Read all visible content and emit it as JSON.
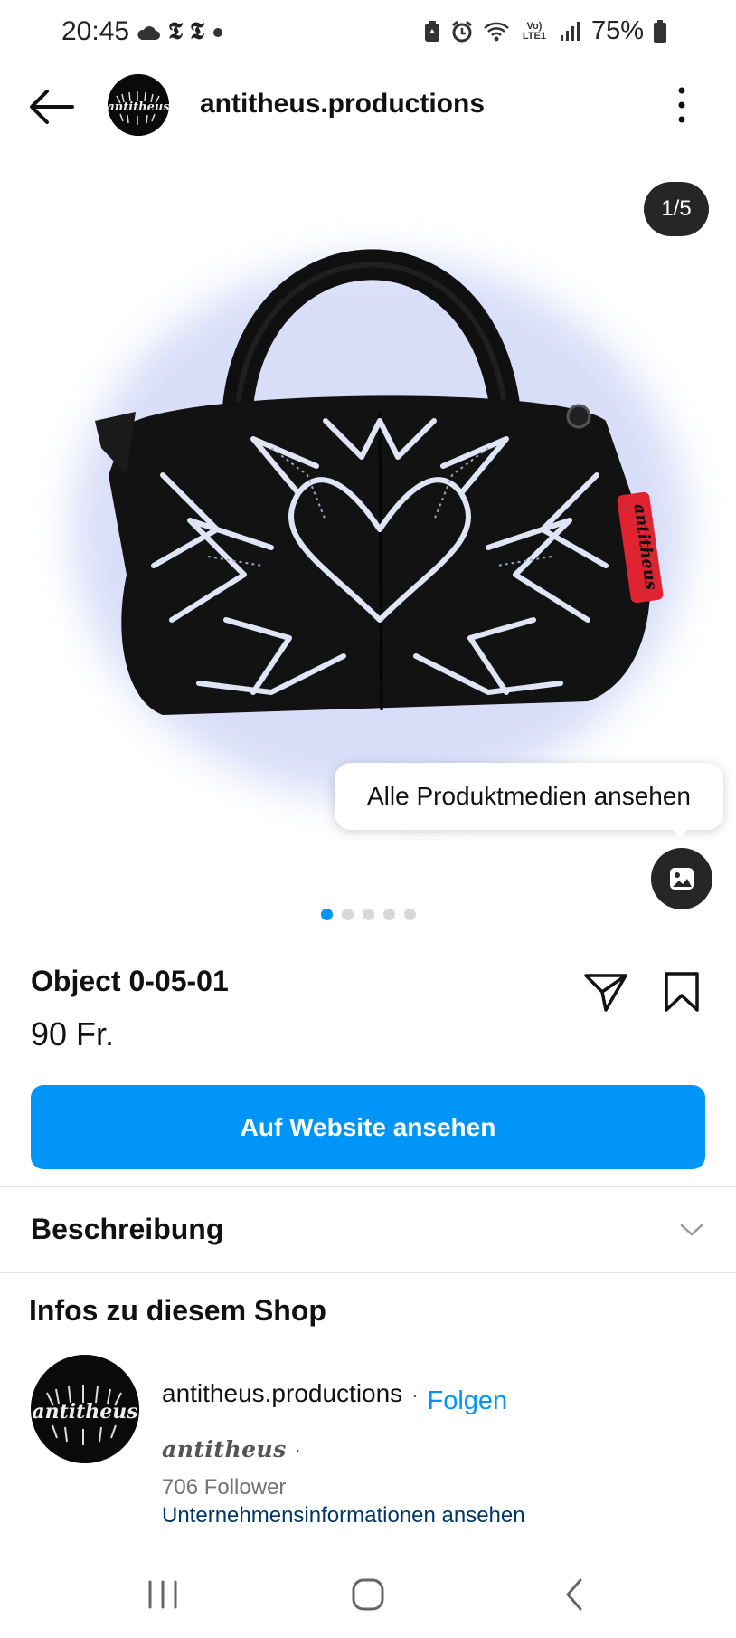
{
  "status_bar": {
    "time": "20:45",
    "battery_percent": "75%",
    "left_icons": [
      "cloud-icon",
      "nytimes-icon",
      "nytimes-icon",
      "dot-icon"
    ],
    "right_icons": [
      "battery-saver-icon",
      "alarm-icon",
      "wifi-icon",
      "volte-icon",
      "signal-icon",
      "battery-icon"
    ],
    "volte_label": "Vo) LTE1",
    "nyt_glyph": "𝕿"
  },
  "header": {
    "username": "antitheus.productions",
    "avatar_text": "antitheus"
  },
  "media": {
    "counter": "1/5",
    "tooltip": "Alle Produktmedien ansehen",
    "slide_count": 5,
    "active_slide": 1,
    "tag_text": "antitheus"
  },
  "product": {
    "name": "Object 0-05-01",
    "price": "90 Fr.",
    "cta_label": "Auf Website ansehen"
  },
  "description": {
    "label": "Beschreibung"
  },
  "shop": {
    "title": "Infos zu diesem Shop",
    "name": "antitheus.productions",
    "separator": "·",
    "follow_label": "Folgen",
    "display_name": "antitheus",
    "display_sep": "·",
    "followers": "706 Follower",
    "business_link": "Unternehmensinformationen ansehen",
    "avatar_text": "antitheus"
  },
  "colors": {
    "accent": "#0095f6",
    "link_dark": "#00376b",
    "badge_bg": "#262626",
    "tag_red": "#e02331"
  }
}
